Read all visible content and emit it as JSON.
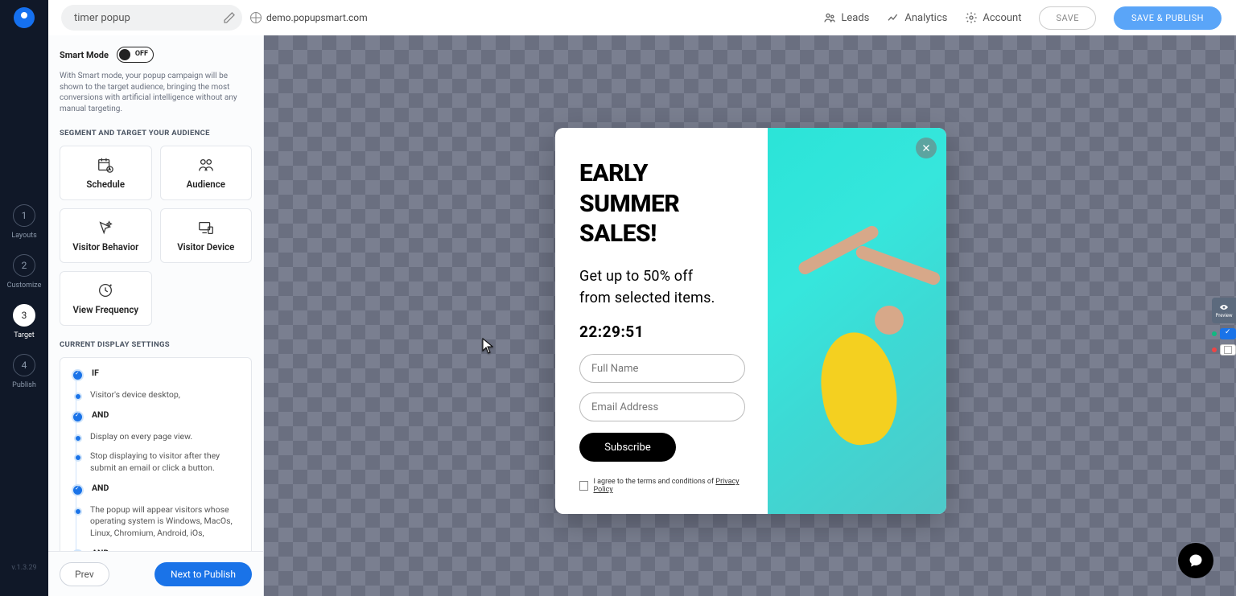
{
  "header": {
    "campaign_name": "timer popup",
    "domain": "demo.popupsmart.com",
    "nav": {
      "leads": "Leads",
      "analytics": "Analytics",
      "account": "Account"
    },
    "save": "SAVE",
    "save_publish": "SAVE & PUBLISH"
  },
  "leftnav": {
    "steps": [
      {
        "num": "1",
        "label": "Layouts"
      },
      {
        "num": "2",
        "label": "Customize"
      },
      {
        "num": "3",
        "label": "Target"
      },
      {
        "num": "4",
        "label": "Publish"
      }
    ],
    "active_index": 2,
    "version": "v.1.3.29"
  },
  "sidebar": {
    "smart_mode": {
      "label": "Smart Mode",
      "state": "OFF"
    },
    "smart_desc": "With Smart mode, your popup campaign will be shown to the target audience, bringing the most conversions with artificial intelligence without any manual targeting.",
    "segment_head": "SEGMENT AND TARGET YOUR AUDIENCE",
    "cards": [
      "Schedule",
      "Audience",
      "Visitor Behavior",
      "Visitor Device",
      "View Frequency"
    ],
    "display_head": "CURRENT DISPLAY SETTINGS",
    "rules": [
      {
        "type": "cond",
        "text": "IF"
      },
      {
        "type": "small",
        "text": "Visitor's device desktop,"
      },
      {
        "type": "cond",
        "text": "AND"
      },
      {
        "type": "small",
        "text": "Display on every page view."
      },
      {
        "type": "small",
        "text": "Stop displaying to visitor after they submit an email or click a button."
      },
      {
        "type": "cond",
        "text": "AND"
      },
      {
        "type": "small",
        "text": "The popup will appear visitors whose operating system is Windows, MacOs, Linux, Chromium, Android, iOs,"
      },
      {
        "type": "cond",
        "text": "AND"
      }
    ],
    "prev": "Prev",
    "next": "Next to Publish"
  },
  "popup": {
    "title_l1": "EARLY",
    "title_l2": "SUMMER",
    "title_l3": "SALES!",
    "sub_l1": "Get up to 50% off",
    "sub_l2": "from selected items.",
    "timer": "22:29:51",
    "name_ph": "Full Name",
    "email_ph": "Email Address",
    "subscribe": "Subscribe",
    "terms_pre": "I agree to the terms and conditions of ",
    "terms_link": "Privacy Policy"
  },
  "right_controls": {
    "preview": "Preview"
  },
  "colors": {
    "accent": "#1a73e8",
    "dot_a": "#10b981",
    "dot_b": "#ef4444"
  }
}
